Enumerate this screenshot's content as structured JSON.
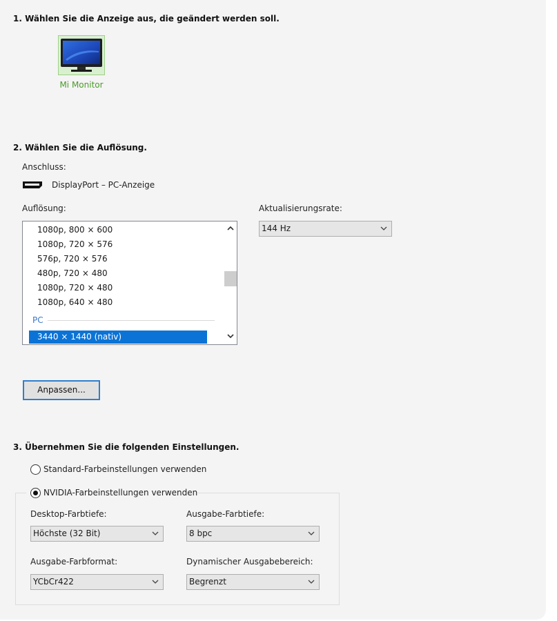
{
  "step1": {
    "heading": "1. Wählen Sie die Anzeige aus, die geändert werden soll.",
    "display_name": "Mi Monitor"
  },
  "step2": {
    "heading": "2. Wählen Sie die Auflösung.",
    "connection_label": "Anschluss:",
    "connection_value": "DisplayPort – PC-Anzeige",
    "resolution_label": "Auflösung:",
    "resolutions": [
      "1080p, 800 × 600",
      "1080p, 720 × 576",
      "576p, 720 × 576",
      "480p, 720 × 480",
      "1080p, 720 × 480",
      "1080p, 640 × 480"
    ],
    "group_label": "PC",
    "selected_resolution": "3440 × 1440 (nativ)",
    "refresh_label": "Aktualisierungsrate:",
    "refresh_value": "144 Hz",
    "customize_button": "Anpassen..."
  },
  "step3": {
    "heading": "3. Übernehmen Sie die folgenden Einstellungen.",
    "radio_default": "Standard-Farbeinstellungen verwenden",
    "radio_nvidia": "NVIDIA-Farbeinstellungen verwenden",
    "desktop_depth_label": "Desktop-Farbtiefe:",
    "desktop_depth_value": "Höchste (32 Bit)",
    "output_depth_label": "Ausgabe-Farbtiefe:",
    "output_depth_value": "8 bpc",
    "output_format_label": "Ausgabe-Farbformat:",
    "output_format_value": "YCbCr422",
    "dynamic_range_label": "Dynamischer Ausgabebereich:",
    "dynamic_range_value": "Begrenzt"
  },
  "colors": {
    "selection": "#0b73d6",
    "display_name": "#4a9b2a",
    "button_border": "#2f7fcd"
  },
  "icons": [
    "monitor-icon",
    "displayport-icon",
    "chevron-up-icon",
    "chevron-down-icon"
  ]
}
